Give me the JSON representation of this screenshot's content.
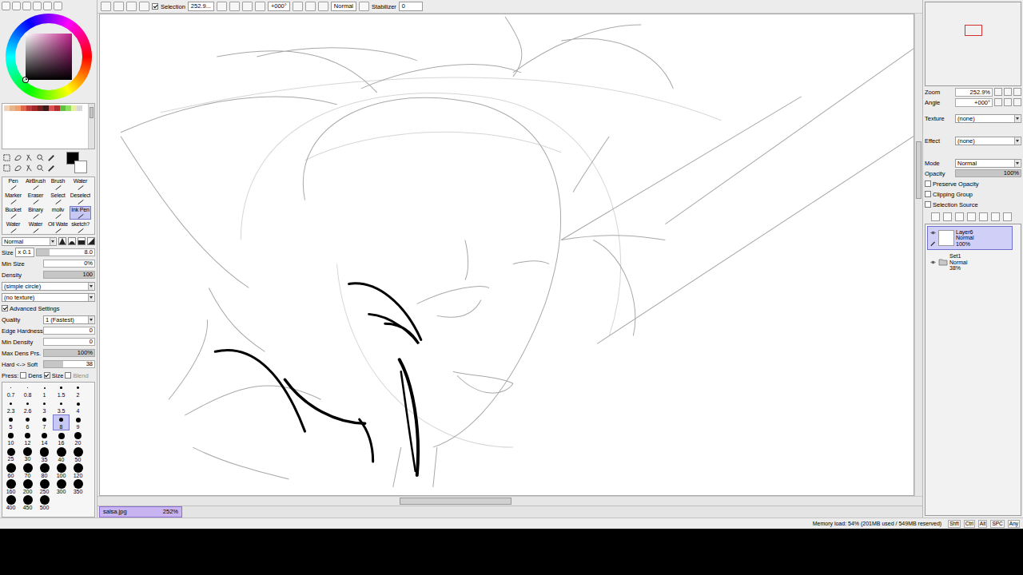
{
  "toolbar": {
    "selection": {
      "label": "Selection",
      "checked": true
    },
    "zoom": "252.9...",
    "angle": "+000°",
    "blend_mode": "Normal",
    "stabilizer": {
      "label": "Stabilizer",
      "value": "0"
    }
  },
  "color": {
    "current": "#000000",
    "secondary": "#ffffff",
    "hue_color": "#c0208a"
  },
  "swatches": [
    {
      "color": "#f0d2b4"
    },
    {
      "color": "#e8b48c"
    },
    {
      "color": "#f0a070"
    },
    {
      "color": "#e06848"
    },
    {
      "color": "#c03838"
    },
    {
      "color": "#a02828"
    },
    {
      "color": "#702020"
    },
    {
      "color": "#401818"
    },
    {
      "color": "#e05050"
    },
    {
      "color": "#b03030"
    },
    {
      "color": "#60c040"
    },
    {
      "color": "#90e060"
    },
    {
      "color": "#e8f0a0"
    },
    {
      "color": "#d8d8d8"
    }
  ],
  "tools": [
    {
      "label": "Pen",
      "selected": false
    },
    {
      "label": "AirBrush",
      "selected": false
    },
    {
      "label": "Brush",
      "selected": false
    },
    {
      "label": "Water",
      "selected": false
    },
    {
      "label": "Marker",
      "selected": false
    },
    {
      "label": "Eraser",
      "selected": false
    },
    {
      "label": "Select",
      "selected": false
    },
    {
      "label": "Deselect",
      "selected": false
    },
    {
      "label": "Bucket",
      "selected": false
    },
    {
      "label": "Binary",
      "selected": false
    },
    {
      "label": "moliv",
      "selected": false
    },
    {
      "label": "Ink Pen",
      "selected": true
    },
    {
      "label": "Water",
      "selected": false
    },
    {
      "label": "Water",
      "selected": false
    },
    {
      "label": "Oil Wate",
      "selected": false
    },
    {
      "label": "sketch?",
      "selected": false
    }
  ],
  "brush_settings": {
    "blend_mode": "Normal",
    "size": {
      "label": "Size",
      "multiplier": "x 0.1",
      "value": "8.0",
      "level": 0.22
    },
    "min_size": {
      "label": "Min Size",
      "value": "0%",
      "level": 0
    },
    "density": {
      "label": "Density",
      "value": "100",
      "level": 1
    },
    "shape": "(simple circle)",
    "texture": "(no texture)",
    "advanced": {
      "label": "Advanced Settings",
      "checked": true
    },
    "quality": {
      "label": "Quality",
      "value": "1 (Fastest)"
    },
    "edge_hardness": {
      "label": "Edge Hardness",
      "value": "0",
      "level": 0
    },
    "min_density": {
      "label": "Min Density",
      "value": "0",
      "level": 0
    },
    "max_dens_prs": {
      "label": "Max Dens Prs.",
      "value": "100%",
      "level": 1
    },
    "hard_soft": {
      "label": "Hard <-> Soft",
      "value": "38",
      "level": 0.38
    },
    "pressure": {
      "label": "Press:",
      "options": [
        {
          "label": "Dens",
          "checked": false
        },
        {
          "label": "Size",
          "checked": true
        },
        {
          "label": "Blend",
          "checked": false
        }
      ]
    }
  },
  "brush_sizes": [
    {
      "label": "0.7",
      "selected": false
    },
    {
      "label": "0.8",
      "selected": false
    },
    {
      "label": "1",
      "selected": false
    },
    {
      "label": "1.5",
      "selected": false
    },
    {
      "label": "2",
      "selected": false
    },
    {
      "label": "2.3",
      "selected": false
    },
    {
      "label": "2.6",
      "selected": false
    },
    {
      "label": "3",
      "selected": false
    },
    {
      "label": "3.5",
      "selected": false
    },
    {
      "label": "4",
      "selected": false
    },
    {
      "label": "5",
      "selected": false
    },
    {
      "label": "6",
      "selected": false
    },
    {
      "label": "7",
      "selected": false
    },
    {
      "label": "8",
      "selected": true
    },
    {
      "label": "9",
      "selected": false
    },
    {
      "label": "10",
      "selected": false
    },
    {
      "label": "12",
      "selected": false
    },
    {
      "label": "14",
      "selected": false
    },
    {
      "label": "16",
      "selected": false
    },
    {
      "label": "20",
      "selected": false
    },
    {
      "label": "25",
      "selected": false
    },
    {
      "label": "30",
      "selected": false
    },
    {
      "label": "35",
      "selected": false
    },
    {
      "label": "40",
      "selected": false
    },
    {
      "label": "50",
      "selected": false
    },
    {
      "label": "60",
      "selected": false
    },
    {
      "label": "70",
      "selected": false
    },
    {
      "label": "80",
      "selected": false
    },
    {
      "label": "100",
      "selected": false
    },
    {
      "label": "120",
      "selected": false
    },
    {
      "label": "160",
      "selected": false
    },
    {
      "label": "200",
      "selected": false
    },
    {
      "label": "250",
      "selected": false
    },
    {
      "label": "300",
      "selected": false
    },
    {
      "label": "350",
      "selected": false
    },
    {
      "label": "400",
      "selected": false
    },
    {
      "label": "450",
      "selected": false
    },
    {
      "label": "500",
      "selected": false
    }
  ],
  "document_tabs": [
    {
      "label": "salsa.jpg",
      "zoom": "252%",
      "selected": true
    }
  ],
  "navigator": {
    "zoom": {
      "label": "Zoom",
      "value": "252.9%"
    },
    "angle": {
      "label": "Angle",
      "value": "+000°"
    }
  },
  "layer_properties": {
    "texture": {
      "label": "Texture",
      "value": "(none)"
    },
    "effect": {
      "label": "Effect",
      "value": "(none)"
    },
    "mode": {
      "label": "Mode",
      "value": "Normal"
    },
    "opacity": {
      "label": "Opacity",
      "value": "100%",
      "level": 1
    },
    "options": [
      {
        "label": "Preserve Opacity",
        "checked": false
      },
      {
        "label": "Clipping Group",
        "checked": false
      },
      {
        "label": "Selection Source",
        "checked": false
      }
    ]
  },
  "layers": [
    {
      "name": "Layer6",
      "mode": "Normal",
      "opacity": "100%",
      "kind": "layer",
      "visible": true,
      "selected": true
    },
    {
      "name": "Set1",
      "mode": "Normal",
      "opacity": "38%",
      "kind": "folder",
      "visible": true,
      "selected": false
    }
  ],
  "status_bar": {
    "memory": "Memory load: 54% (201MB used / 549MB reserved)",
    "keys": [
      "Shft",
      "Ctrl",
      "Alt",
      "SPC",
      "Any"
    ]
  }
}
